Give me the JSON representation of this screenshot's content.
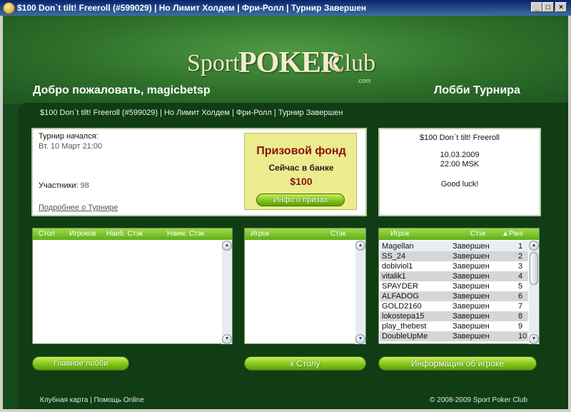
{
  "window": {
    "title": "$100 Don`t tilt! Freeroll (#599029)   |   Но Лимит Холдем   |   Фри-Ролл   |   Турнир Завершен",
    "minimize": "_",
    "maximize": "□",
    "close": "×"
  },
  "header": {
    "logo_sport": "Sport",
    "logo_poker": "POKER",
    "logo_club": "Club",
    "logo_com": ".com",
    "welcome": "Добро пожаловать, magicbetsp",
    "lobby_title": "Лобби Турнира"
  },
  "breadcrumb": "$100 Don`t tilt! Freeroll (#599029)  |  Но Лимит Холдем  |  Фри-Ролл   |  Турнир Завершен",
  "tournament": {
    "started_label": "Турнир начался:",
    "started_date": "Вт. 10 Март 21:00",
    "participants_label": "Участники:",
    "participants_value": "98",
    "more_link": "Подробнее о Турнире"
  },
  "prize": {
    "title": "Призовой фонд",
    "subtitle": "Сейчас в банке",
    "amount": "$100",
    "button": "Инфо о призах"
  },
  "info": {
    "line1": "$100 Don`t tilt! Freeroll",
    "line2": "10.03.2009",
    "line3": "22:00 MSK",
    "line4": "Good luck!"
  },
  "tables_list": {
    "headers": [
      "Стол",
      "Игроков",
      "Наиб. Стэк",
      "Наим. Стэк"
    ]
  },
  "table_players_list": {
    "headers": [
      "Игрок",
      "Стэк"
    ]
  },
  "players_list": {
    "headers": [
      "Игрок",
      "Стэк",
      "▲Ранг"
    ],
    "rows": [
      {
        "player": "Magellan",
        "status": "Завершен",
        "rank": "1"
      },
      {
        "player": "SS_24",
        "status": "Завершен",
        "rank": "2"
      },
      {
        "player": "dobiviol1",
        "status": "Завершен",
        "rank": "3"
      },
      {
        "player": "vitalik1",
        "status": "Завершен",
        "rank": "4"
      },
      {
        "player": "SPAYDER",
        "status": "Завершен",
        "rank": "5"
      },
      {
        "player": "ALFADOG",
        "status": "Завершен",
        "rank": "6"
      },
      {
        "player": "GOLD2160",
        "status": "Завершен",
        "rank": "7"
      },
      {
        "player": "lokostepa15",
        "status": "Завершен",
        "rank": "8"
      },
      {
        "player": "play_thebest",
        "status": "Завершен",
        "rank": "9"
      },
      {
        "player": "DoubleUpMe",
        "status": "Завершен",
        "rank": "10"
      }
    ]
  },
  "buttons": {
    "main_lobby": "Главное лобби",
    "to_table": "к Столу",
    "player_info": "Информация об игроке"
  },
  "footer": {
    "left": "Клубная карта  |  Помощь Online",
    "right": "© 2008-2009 Sport Poker Club"
  }
}
